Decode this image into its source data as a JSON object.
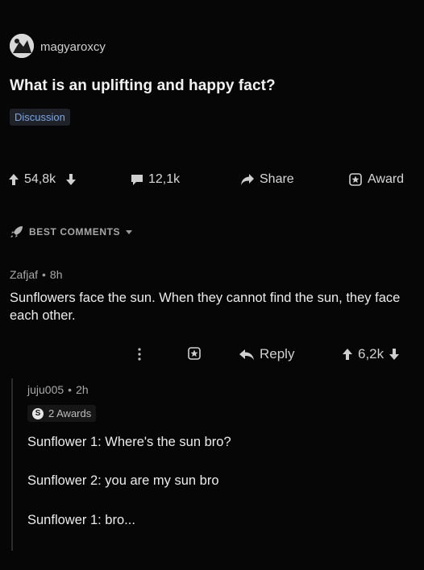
{
  "post": {
    "author": "magyaroxcy",
    "title": "What is an uplifting and happy fact?",
    "flair": "Discussion"
  },
  "action_bar": {
    "score": "54,8k",
    "comments": "12,1k",
    "share_label": "Share",
    "award_label": "Award"
  },
  "sort": {
    "label": "BEST COMMENTS"
  },
  "comment": {
    "author": "Zafjaf",
    "time": "8h",
    "body": "Sunflowers face the sun.  When they cannot find the sun, they face each other.",
    "reply_label": "Reply",
    "score": "6,2k"
  },
  "reply": {
    "author": "juju005",
    "time": "2h",
    "awards_label": "2 Awards",
    "award_badge": "S",
    "lines": [
      "Sunflower 1: Where's the sun bro?",
      "Sunflower 2: you are my sun bro",
      "Sunflower 1: bro..."
    ]
  },
  "colors": {
    "background": "#060606",
    "flair_bg": "#1f2228",
    "flair_text": "#7aa6e6"
  }
}
